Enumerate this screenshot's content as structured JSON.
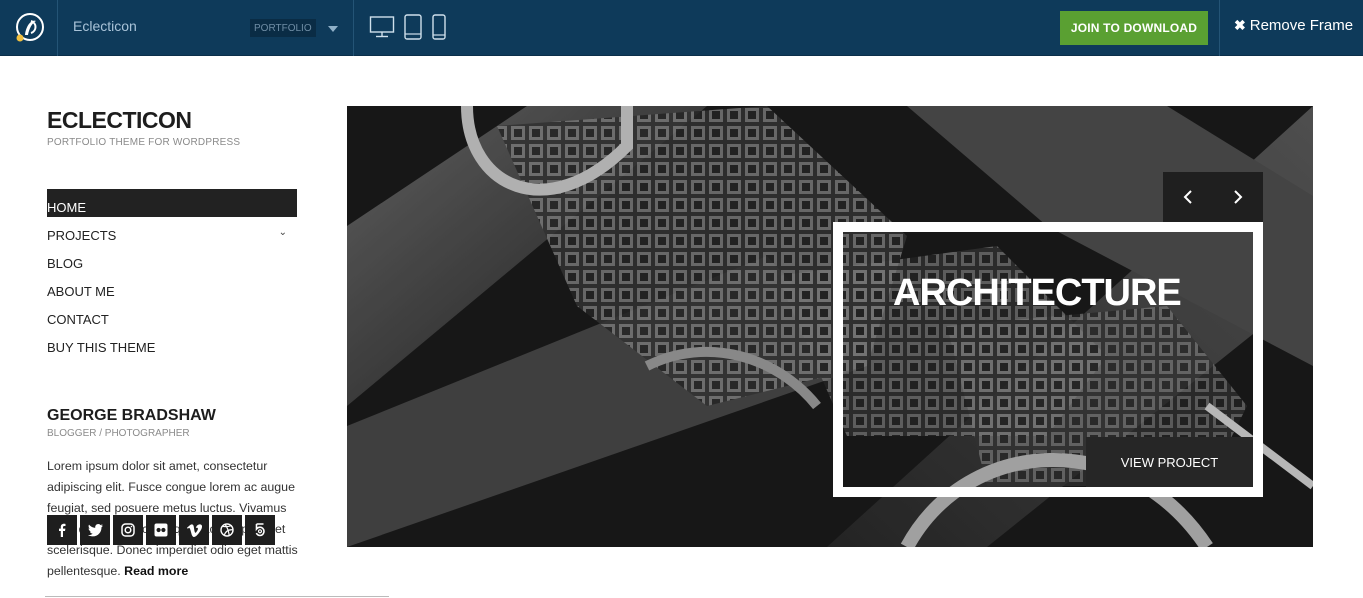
{
  "topbar": {
    "logo_icon": "brush-logo-icon",
    "site_name": "Eclecticon",
    "badge": "PORTFOLIO",
    "devices": [
      "desktop-icon",
      "tablet-icon",
      "mobile-icon"
    ],
    "join_label": "JOIN TO DOWNLOAD",
    "remove_label": "Remove Frame",
    "colors": {
      "bar": "#0e3a5a",
      "join": "#5aa032"
    }
  },
  "sidebar": {
    "brand": "ECLECTICON",
    "tagline": "PORTFOLIO THEME FOR WORDPRESS",
    "nav": [
      {
        "label": "HOME",
        "active": true
      },
      {
        "label": "PROJECTS",
        "has_submenu": true
      },
      {
        "label": "BLOG"
      },
      {
        "label": "ABOUT ME"
      },
      {
        "label": "CONTACT"
      },
      {
        "label": "BUY THIS THEME"
      }
    ],
    "author": {
      "name": "GEORGE BRADSHAW",
      "role": "BLOGGER / PHOTOGRAPHER",
      "bio": "Lorem ipsum dolor sit amet, consectetur adipiscing elit. Fusce congue lorem ac augue feugiat, sed posuere metus luctus. Vivamus porta dui et dui iaculis, quis lacinia ipsum et scelerisque. Donec imperdiet odio eget mattis pellentesque.",
      "read_more": "Read more"
    },
    "social": [
      "facebook-icon",
      "twitter-icon",
      "instagram-icon",
      "flickr-icon",
      "vimeo-icon",
      "dribbble-icon",
      "500px-icon"
    ]
  },
  "hero": {
    "title": "ARCHITECTURE",
    "cta": "VIEW PROJECT",
    "prev_icon": "chevron-left-icon",
    "next_icon": "chevron-right-icon"
  }
}
